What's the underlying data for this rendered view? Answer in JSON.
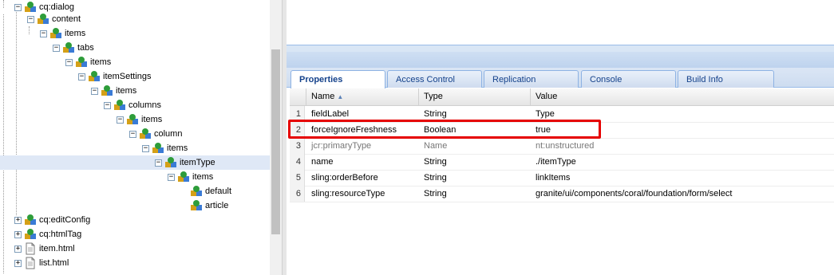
{
  "tree": {
    "nodes": [
      {
        "label": "cq:dialog",
        "toggle": "−",
        "icon": "node-icon"
      },
      {
        "label": "content",
        "toggle": "−",
        "icon": "node-icon"
      },
      {
        "label": "items",
        "toggle": "−",
        "icon": "node-icon"
      },
      {
        "label": "tabs",
        "toggle": "−",
        "icon": "node-icon"
      },
      {
        "label": "items",
        "toggle": "−",
        "icon": "node-icon"
      },
      {
        "label": "itemSettings",
        "toggle": "−",
        "icon": "node-icon"
      },
      {
        "label": "items",
        "toggle": "−",
        "icon": "node-icon"
      },
      {
        "label": "columns",
        "toggle": "−",
        "icon": "node-icon"
      },
      {
        "label": "items",
        "toggle": "−",
        "icon": "node-icon"
      },
      {
        "label": "column",
        "toggle": "−",
        "icon": "node-icon"
      },
      {
        "label": "items",
        "toggle": "−",
        "icon": "node-icon"
      },
      {
        "label": "itemType",
        "toggle": "−",
        "icon": "node-icon",
        "selected": true
      },
      {
        "label": "items",
        "toggle": "−",
        "icon": "node-icon"
      },
      {
        "label": "default",
        "toggle": "",
        "icon": "node-icon"
      },
      {
        "label": "article",
        "toggle": "",
        "icon": "node-icon"
      },
      {
        "label": "cq:editConfig",
        "toggle": "+",
        "icon": "node-icon"
      },
      {
        "label": "cq:htmlTag",
        "toggle": "+",
        "icon": "node-icon"
      },
      {
        "label": "item.html",
        "toggle": "+",
        "icon": "file-icon"
      },
      {
        "label": "list.html",
        "toggle": "+",
        "icon": "file-icon"
      }
    ]
  },
  "tabs": [
    {
      "label": "Properties",
      "active": true
    },
    {
      "label": "Access Control"
    },
    {
      "label": "Replication"
    },
    {
      "label": "Console"
    },
    {
      "label": "Build Info"
    }
  ],
  "grid": {
    "headers": {
      "name": "Name",
      "type": "Type",
      "value": "Value",
      "sort_icon": "▲"
    },
    "rows": [
      {
        "num": "1",
        "name": "fieldLabel",
        "type": "String",
        "value": "Type"
      },
      {
        "num": "2",
        "name": "forceIgnoreFreshness",
        "type": "Boolean",
        "value": "true",
        "highlighted": true
      },
      {
        "num": "3",
        "name": "jcr:primaryType",
        "type": "Name",
        "value": "nt:unstructured",
        "protected": true
      },
      {
        "num": "4",
        "name": "name",
        "type": "String",
        "value": "./itemType"
      },
      {
        "num": "5",
        "name": "sling:orderBefore",
        "type": "String",
        "value": "linkItems"
      },
      {
        "num": "6",
        "name": "sling:resourceType",
        "type": "String",
        "value": "granite/ui/components/coral/foundation/form/select"
      }
    ]
  },
  "colors": {
    "highlight": "#e60000",
    "tab_text": "#15428b",
    "selection": "#dfe8f6"
  }
}
